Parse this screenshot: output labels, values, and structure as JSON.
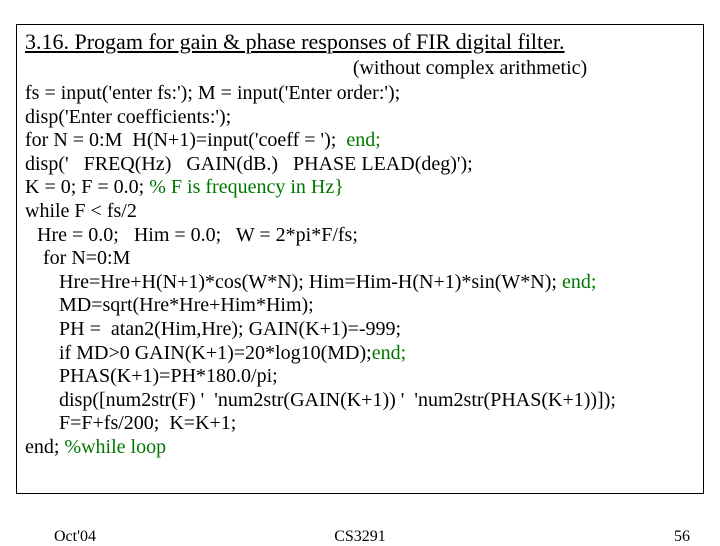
{
  "title": "3.16. Progam for gain & phase responses of FIR digital filter.",
  "subtitle": "(without complex arithmetic)",
  "lines": {
    "l1": "fs = input('enter fs:'); M = input('Enter order:');",
    "l2": "disp('Enter coefficients:');",
    "l3a": "for N = 0:M  H(N+1)=input('coeff = ');  ",
    "l3b": "end;",
    "l4": "disp('   FREQ(Hz)   GAIN(dB.)   PHASE LEAD(deg)');",
    "l5a": "K = 0; F = 0.0; ",
    "l5b": "% F is frequency in Hz}",
    "l6": "while F < fs/2",
    "l7": "Hre = 0.0;   Him = 0.0;   W = 2*pi*F/fs;",
    "l8": "for N=0:M",
    "l9a": "Hre=Hre+H(N+1)*cos(W*N); Him=Him-H(N+1)*sin(W*N); ",
    "l9b": "end;",
    "l10": "MD=sqrt(Hre*Hre+Him*Him);",
    "l11": "PH =  atan2(Him,Hre); GAIN(K+1)=-999;",
    "l12a": "if MD>0 GAIN(K+1)=20*log10(MD);",
    "l12b": "end;",
    "l13": "PHAS(K+1)=PH*180.0/pi;",
    "l14": "disp([num2str(F) '  'num2str(GAIN(K+1)) '  'num2str(PHAS(K+1))]);",
    "l15": "F=F+fs/200;  K=K+1;",
    "l16a": "end; ",
    "l16b": "%while loop"
  },
  "footer": {
    "left": "Oct'04",
    "center": "CS3291",
    "right": "56"
  }
}
